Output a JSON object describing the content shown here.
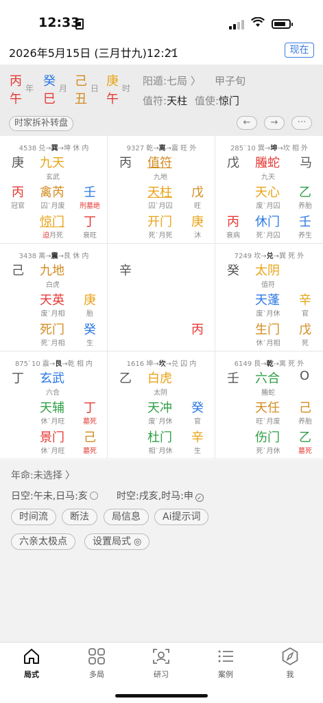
{
  "status": {
    "time": "12:33"
  },
  "date_bar": {
    "date": "2026年5月15日 (三月廿九)12:21",
    "chevron": "﹀",
    "now_button": "现在"
  },
  "header": {
    "ganzhi": [
      {
        "gan": "丙",
        "zhi": "午",
        "label": "年",
        "gan_color": "#e53935",
        "zhi_color": "#e53935"
      },
      {
        "gan": "癸",
        "zhi": "巳",
        "label": "月",
        "gan_color": "#2b78e4",
        "zhi_color": "#e53935"
      },
      {
        "gan": "己",
        "zhi": "丑",
        "label": "日",
        "gan_color": "#d38a1f",
        "zhi_color": "#d38a1f"
      },
      {
        "gan": "庚",
        "zhi": "午",
        "label": "时",
        "gan_color": "#e8a317",
        "zhi_color": "#e53935"
      }
    ],
    "yinyang": "阳遁:七局 〉",
    "xun": "甲子旬",
    "zhifu_label": "值符:",
    "zhifu_value": "天柱",
    "zhishi_label": "值使:",
    "zhishi_value": "惊门",
    "chaibu": "时家拆补转盘",
    "prev": "←",
    "next": "→",
    "more": "···"
  },
  "palaces": [
    {
      "top": [
        "4538 兑→",
        "巽",
        "→坤 休 内"
      ],
      "left_stem": "庚",
      "left_stem_color": "#555",
      "god": "九天",
      "god_color": "#e8a317",
      "god_sub": "玄武",
      "star_stem": "丙",
      "star_stem_color": "#e53935",
      "star_stem_sub": "冠官",
      "star": "禽芮",
      "star_color": "#d38a1f",
      "star_sub": "囚`月废",
      "star_r": "壬",
      "star_r_color": "#2b78e4",
      "star_r_sub": "刑墓绝",
      "star_r_sub_color": "#e53935",
      "door": "惊门",
      "door_color": "#e8a317",
      "door_under": true,
      "door_sub_prefix": "迫",
      "door_sub": "月死",
      "door_r": "丁",
      "door_r_color": "#e53935",
      "door_r_sub": "衰旺",
      "extra": ""
    },
    {
      "top": [
        "9327 乾→",
        "离",
        "→震 旺 外"
      ],
      "left_stem": "丙",
      "left_stem_color": "#555",
      "god": "值符",
      "god_color": "#d38a1f",
      "god_under": true,
      "god_sub": "九地",
      "star_stem": "",
      "star_stem_color": "#555",
      "star_stem_sub": "",
      "star": "天柱",
      "star_color": "#e8a317",
      "star_under": true,
      "star_sub": "囚`月囚",
      "star_r": "戊",
      "star_r_color": "#d38a1f",
      "star_r_sub": "旺",
      "door": "开门",
      "door_color": "#e8a317",
      "door_sub": "死`月死",
      "door_r": "庚",
      "door_r_color": "#e8a317",
      "door_r_sub": "沐",
      "extra": ""
    },
    {
      "top": [
        "285`10 巽→",
        "坤",
        "→坎 相 外"
      ],
      "left_stem": "戊",
      "left_stem_color": "#555",
      "god": "螣蛇",
      "god_color": "#e53935",
      "god_sub": "九天",
      "god_r": "马",
      "god_r_color": "#555",
      "star_stem": "",
      "star_stem_color": "#555",
      "star_stem_sub": "",
      "star": "天心",
      "star_color": "#e8a317",
      "star_sub": "废`月囚",
      "star_r": "乙",
      "star_r_color": "#2e9e44",
      "star_r_sub": "养胎",
      "door_l": "丙",
      "door_l_color": "#e53935",
      "door_l_sub": "衰病",
      "door": "休门",
      "door_color": "#2b78e4",
      "door_sub": "死`月囚",
      "door_r": "壬",
      "door_r_color": "#2b78e4",
      "door_r_sub": "养生",
      "extra": ""
    },
    {
      "top": [
        "3438 离→",
        "震",
        "→艮 休 内"
      ],
      "left_stem": "己",
      "left_stem_color": "#555",
      "god": "九地",
      "god_color": "#d38a1f",
      "god_sub": "白虎",
      "star_stem": "",
      "star_stem_color": "#555",
      "star_stem_sub": "",
      "star": "天英",
      "star_color": "#e53935",
      "star_sub": "废`月相",
      "star_r": "庚",
      "star_r_color": "#e8a317",
      "star_r_sub": "胎",
      "door": "死门",
      "door_color": "#d38a1f",
      "door_sub": "死`月相",
      "door_r": "癸",
      "door_r_color": "#2b78e4",
      "door_r_sub": "生",
      "extra": ""
    },
    {
      "top": [
        "",
        "",
        ""
      ],
      "left_stem": "辛",
      "left_stem_color": "#555",
      "god": "",
      "god_color": "#555",
      "god_sub": "",
      "star": "",
      "star_color": "#555",
      "star_sub": "",
      "star_stem": "",
      "star_stem_color": "#555",
      "star_stem_sub": "",
      "star_r": "",
      "star_r_color": "#555",
      "star_r_sub": "",
      "door": "",
      "door_color": "#555",
      "door_sub": "",
      "door_r": "丙",
      "door_r_color": "#e53935",
      "door_r_sub": "",
      "extra": ""
    },
    {
      "top": [
        "7249 坎→",
        "兑",
        "→巽 死 外"
      ],
      "left_stem": "癸",
      "left_stem_color": "#555",
      "god": "太阴",
      "god_color": "#e8a317",
      "god_sub": "值符",
      "star_stem": "",
      "star_stem_color": "#555",
      "star_stem_sub": "",
      "star": "天蓬",
      "star_color": "#2b78e4",
      "star_sub": "废`月休",
      "star_r": "辛",
      "star_r_color": "#e8a317",
      "star_r_sub": "官",
      "door": "生门",
      "door_color": "#d38a1f",
      "door_sub": "休`月相",
      "door_r": "戊",
      "door_r_color": "#d38a1f",
      "door_r_sub": "死",
      "extra": ""
    },
    {
      "top": [
        "875`10 震→",
        "艮",
        "→乾 相 内"
      ],
      "left_stem": "丁",
      "left_stem_color": "#555",
      "god": "玄武",
      "god_color": "#2b78e4",
      "god_sub": "六合",
      "star_stem": "",
      "star_stem_color": "#555",
      "star_stem_sub": "",
      "star": "天辅",
      "star_color": "#2e9e44",
      "star_sub": "休`月旺",
      "star_r": "丁",
      "star_r_color": "#e53935",
      "star_r_sub": "墓死",
      "star_r_sub_color": "#e53935",
      "door": "景门",
      "door_color": "#e53935",
      "door_sub": "休`月旺",
      "door_r": "己",
      "door_r_color": "#d38a1f",
      "door_r_sub": "墓死",
      "door_r_sub_color": "#e53935",
      "extra": ""
    },
    {
      "top": [
        "1616 坤→",
        "坎",
        "→兑 囚 内"
      ],
      "left_stem": "乙",
      "left_stem_color": "#555",
      "god": "白虎",
      "god_color": "#e8a317",
      "god_sub": "太阴",
      "star_stem": "",
      "star_stem_color": "#555",
      "star_stem_sub": "",
      "star": "天冲",
      "star_color": "#2e9e44",
      "star_sub": "废`月休",
      "star_r": "癸",
      "star_r_color": "#2b78e4",
      "star_r_sub": "官",
      "door": "杜门",
      "door_color": "#2e9e44",
      "door_sub": "相`月休",
      "door_r": "辛",
      "door_r_color": "#e8a317",
      "door_r_sub": "生",
      "extra": ""
    },
    {
      "top": [
        "6149 艮→",
        "乾",
        "→离 死 外"
      ],
      "left_stem": "壬",
      "left_stem_color": "#555",
      "god": "六合",
      "god_color": "#2e9e44",
      "god_sub": "螣蛇",
      "god_r": "O",
      "god_r_color": "#555",
      "star_stem": "",
      "star_stem_color": "#555",
      "star_stem_sub": "",
      "star": "天任",
      "star_color": "#d38a1f",
      "star_sub": "旺`月废",
      "star_r": "己",
      "star_r_color": "#d38a1f",
      "star_r_sub": "养胎",
      "door": "伤门",
      "door_color": "#2e9e44",
      "door_sub": "死`月休",
      "door_r": "乙",
      "door_r_color": "#2e9e44",
      "door_r_sub": "墓死",
      "door_r_sub_color": "#e53935",
      "extra": ""
    }
  ],
  "info": {
    "nianming": "年命:未选择 〉",
    "rikong": "日空:午未,日马:亥",
    "shikong": "时空:戌亥,时马:申",
    "pills_row1": [
      "时间流",
      "断法",
      "局信息",
      "Ai提示词"
    ],
    "pills_row2": [
      "六亲太极点",
      "设置局式"
    ]
  },
  "tabs": [
    {
      "label": "局式",
      "icon": "home-icon",
      "active": true
    },
    {
      "label": "多局",
      "icon": "grid-icon",
      "active": false
    },
    {
      "label": "研习",
      "icon": "scan-icon",
      "active": false
    },
    {
      "label": "案例",
      "icon": "list-icon",
      "active": false
    },
    {
      "label": "我",
      "icon": "compass-icon",
      "active": false
    }
  ]
}
